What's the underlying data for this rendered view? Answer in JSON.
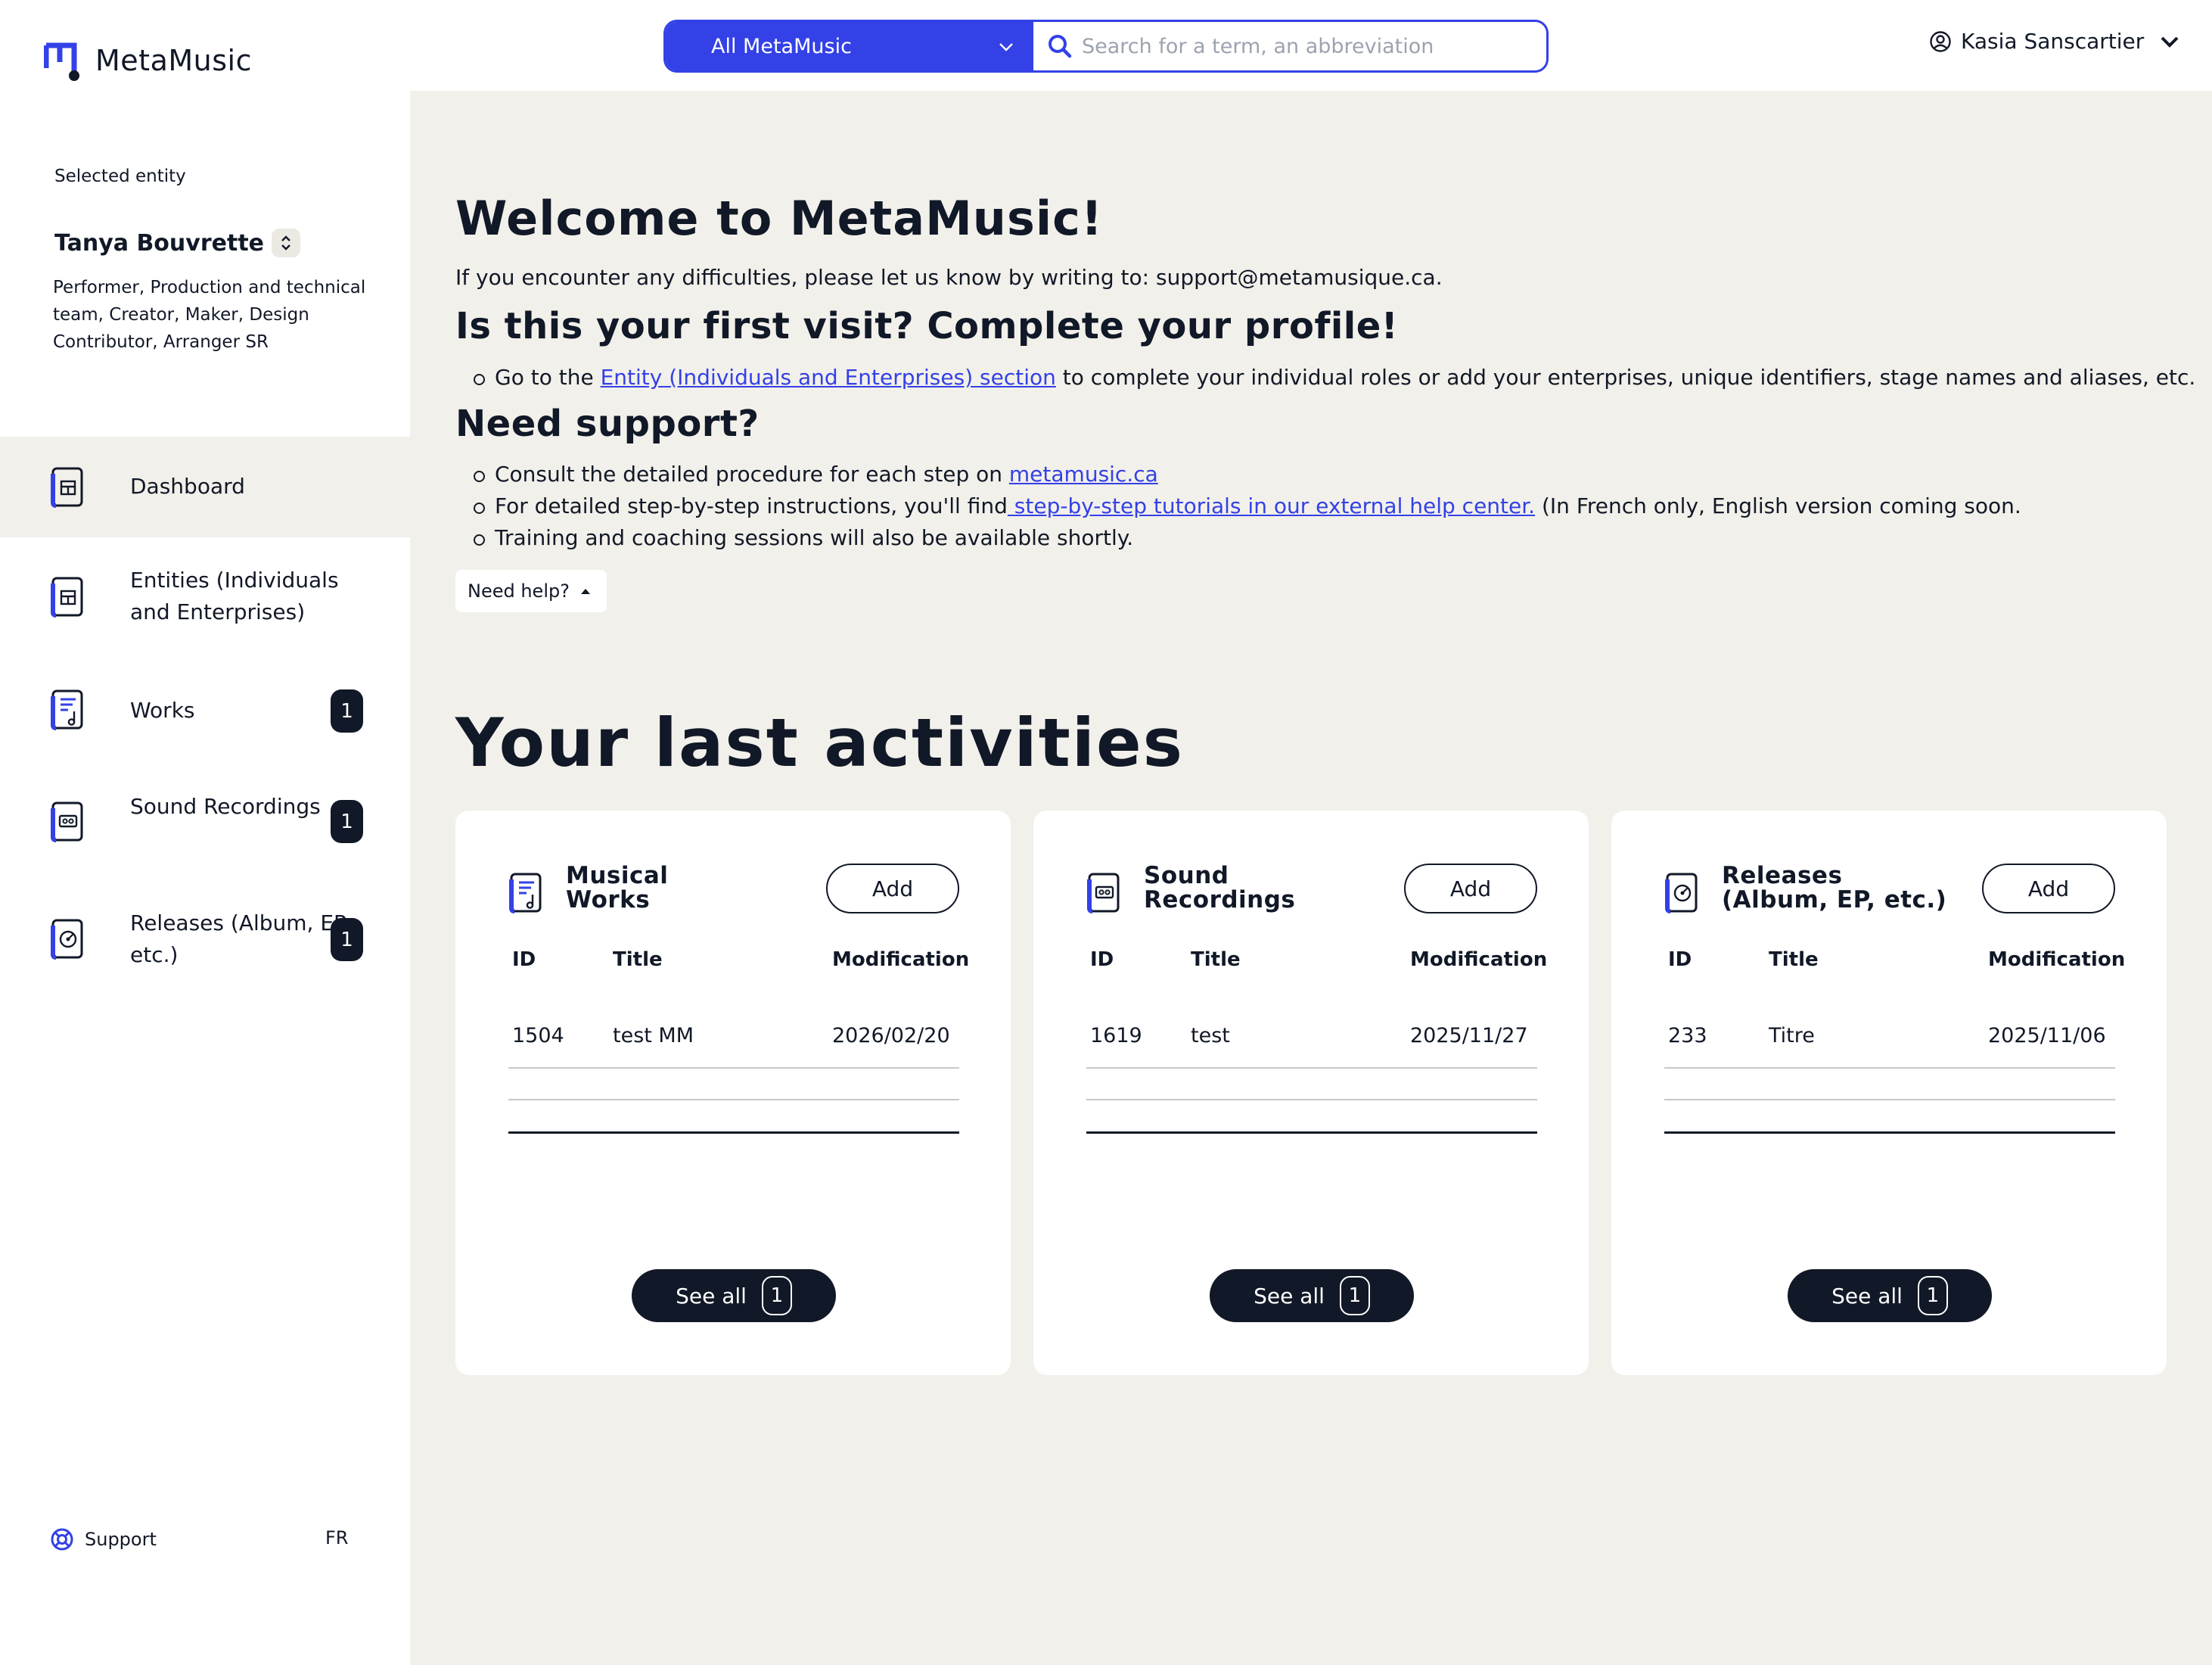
{
  "app": {
    "name": "MetaMusic"
  },
  "search": {
    "scope": "All MetaMusic",
    "placeholder": "Search for a term, an abbreviation",
    "value": ""
  },
  "user": {
    "name": "Kasia Sanscartier"
  },
  "sidebar": {
    "selected_label": "Selected entity",
    "entity_name": "Tanya Bouvrette",
    "entity_roles": "Performer, Production and technical team, Creator, Maker, Design Contributor, Arranger SR",
    "items": [
      {
        "label": "Dashboard",
        "icon": "dashboard-icon",
        "badge": null
      },
      {
        "label": "Entities (Individuals and Enterprises)",
        "icon": "entities-icon",
        "badge": null
      },
      {
        "label": "Works",
        "icon": "works-icon",
        "badge": "1"
      },
      {
        "label": "Sound Recordings",
        "icon": "sound-recordings-icon",
        "badge": "1"
      },
      {
        "label": "Releases (Album, EP, etc.)",
        "icon": "releases-icon",
        "badge": "1"
      }
    ],
    "support_label": "Support",
    "language": "FR"
  },
  "main": {
    "welcome_title": "Welcome to MetaMusic!",
    "contact_text": "If you encounter any difficulties, please let us know by writing to: support@metamusique.ca.",
    "first_visit_title": "Is this your first visit? Complete your profile!",
    "first_visit_bullet": {
      "before": "Go to the ",
      "link": "Entity (Individuals and Enterprises) section",
      "after": " to complete your individual roles or add your enterprises, unique identifiers, stage names and aliases, etc."
    },
    "support_title": "Need support?",
    "support_bullets": [
      {
        "before": "Consult the detailed procedure for each step on ",
        "link": "metamusic.ca",
        "after": ""
      },
      {
        "before": "For detailed step-by-step instructions, you'll find",
        "link": " step-by-step tutorials in our external help center.",
        "after": " (In French only, English version coming soon."
      },
      {
        "before": "Training and coaching sessions will also be available shortly.",
        "link": "",
        "after": ""
      }
    ],
    "help_button": "Need help?",
    "activities_title": "Your last activities"
  },
  "cards": [
    {
      "title_line1": "Musical",
      "title_line2": "Works",
      "icon": "works-icon",
      "add_label": "Add",
      "columns": [
        "ID",
        "Title",
        "Modification"
      ],
      "rows": [
        {
          "id": "1504",
          "title": "test MM",
          "modified": "2026/02/20"
        }
      ],
      "see_all_label": "See all",
      "see_all_count": "1"
    },
    {
      "title_line1": "Sound",
      "title_line2": "Recordings",
      "icon": "sound-recordings-icon",
      "add_label": "Add",
      "columns": [
        "ID",
        "Title",
        "Modification"
      ],
      "rows": [
        {
          "id": "1619",
          "title": "test",
          "modified": "2025/11/27"
        }
      ],
      "see_all_label": "See all",
      "see_all_count": "1"
    },
    {
      "title_line1": "Releases",
      "title_line2": "(Album, EP, etc.)",
      "icon": "releases-icon",
      "add_label": "Add",
      "columns": [
        "ID",
        "Title",
        "Modification"
      ],
      "rows": [
        {
          "id": "233",
          "title": "Titre",
          "modified": "2025/11/06"
        }
      ],
      "see_all_label": "See all",
      "see_all_count": "1"
    }
  ],
  "colors": {
    "accent": "#3341e6",
    "dark": "#111827",
    "background": "#f2f0ea"
  }
}
